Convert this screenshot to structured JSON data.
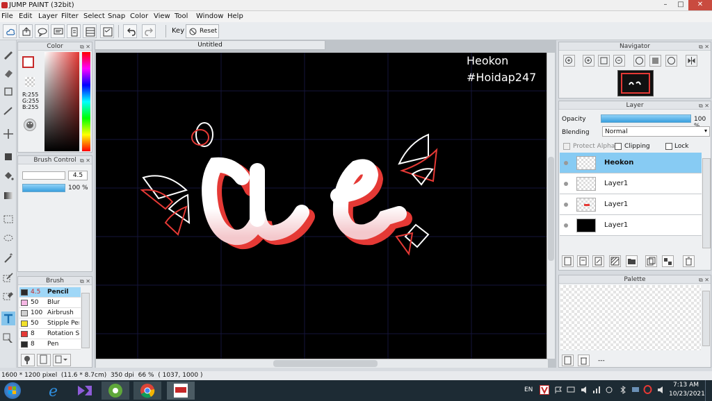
{
  "window": {
    "title": "JUMP PAINT (32bit)",
    "controls": [
      "–",
      "□",
      "✕"
    ]
  },
  "menu": [
    "File",
    "Edit",
    "Layer",
    "Filter",
    "Select",
    "Snap",
    "Color",
    "View",
    "Tool",
    "Window",
    "Help"
  ],
  "toolbar": {
    "key_label": "Key",
    "reset_label": "Reset"
  },
  "color_panel": {
    "title": "Color",
    "r": "R:255",
    "g": "G:255",
    "b": "B:255",
    "primary": "#ffffff",
    "secondary": "#e53935"
  },
  "brush_control": {
    "title": "Brush Control",
    "size": "4.5",
    "opacity": "100 %"
  },
  "brush_panel": {
    "title": "Brush",
    "items": [
      {
        "size": "4.5",
        "name": "Pencil",
        "color": "#2b2b2b"
      },
      {
        "size": "50",
        "name": "Blur",
        "color": "#f5b6e3"
      },
      {
        "size": "100",
        "name": "Airbrush",
        "color": "#cfcfcf"
      },
      {
        "size": "50",
        "name": "Stipple Pen",
        "color": "#f2e12a"
      },
      {
        "size": "8",
        "name": "Rotation Sy",
        "color": "#e53935"
      },
      {
        "size": "8",
        "name": "Pen",
        "color": "#2b2b2b"
      }
    ]
  },
  "canvas": {
    "tab_title": "Untitled",
    "watermark_line1": "Heokon",
    "watermark_line2": "#Hoidap247"
  },
  "navigator": {
    "title": "Navigator"
  },
  "layer_panel": {
    "title": "Layer",
    "opacity_label": "Opacity",
    "opacity_value": "100 %",
    "opacity_fraction": 1.0,
    "blending_label": "Blending",
    "blending_value": "Normal",
    "protect_alpha": "Protect Alpha",
    "clipping": "Clipping",
    "lock": "Lock",
    "layers": [
      {
        "name": "Heokon",
        "selected": true
      },
      {
        "name": "Layer1",
        "selected": false
      },
      {
        "name": "Layer1",
        "selected": false
      },
      {
        "name": "Layer1",
        "selected": false
      }
    ]
  },
  "palette_panel": {
    "title": "Palette",
    "footer": "---"
  },
  "status": {
    "text": "1600 * 1200 pixel  (11.6 * 8.7cm)  350 dpi  66 %  ( 1037, 1000 )"
  },
  "taskbar": {
    "lang": "EN",
    "time": "7:13 AM",
    "date": "10/23/2021"
  }
}
